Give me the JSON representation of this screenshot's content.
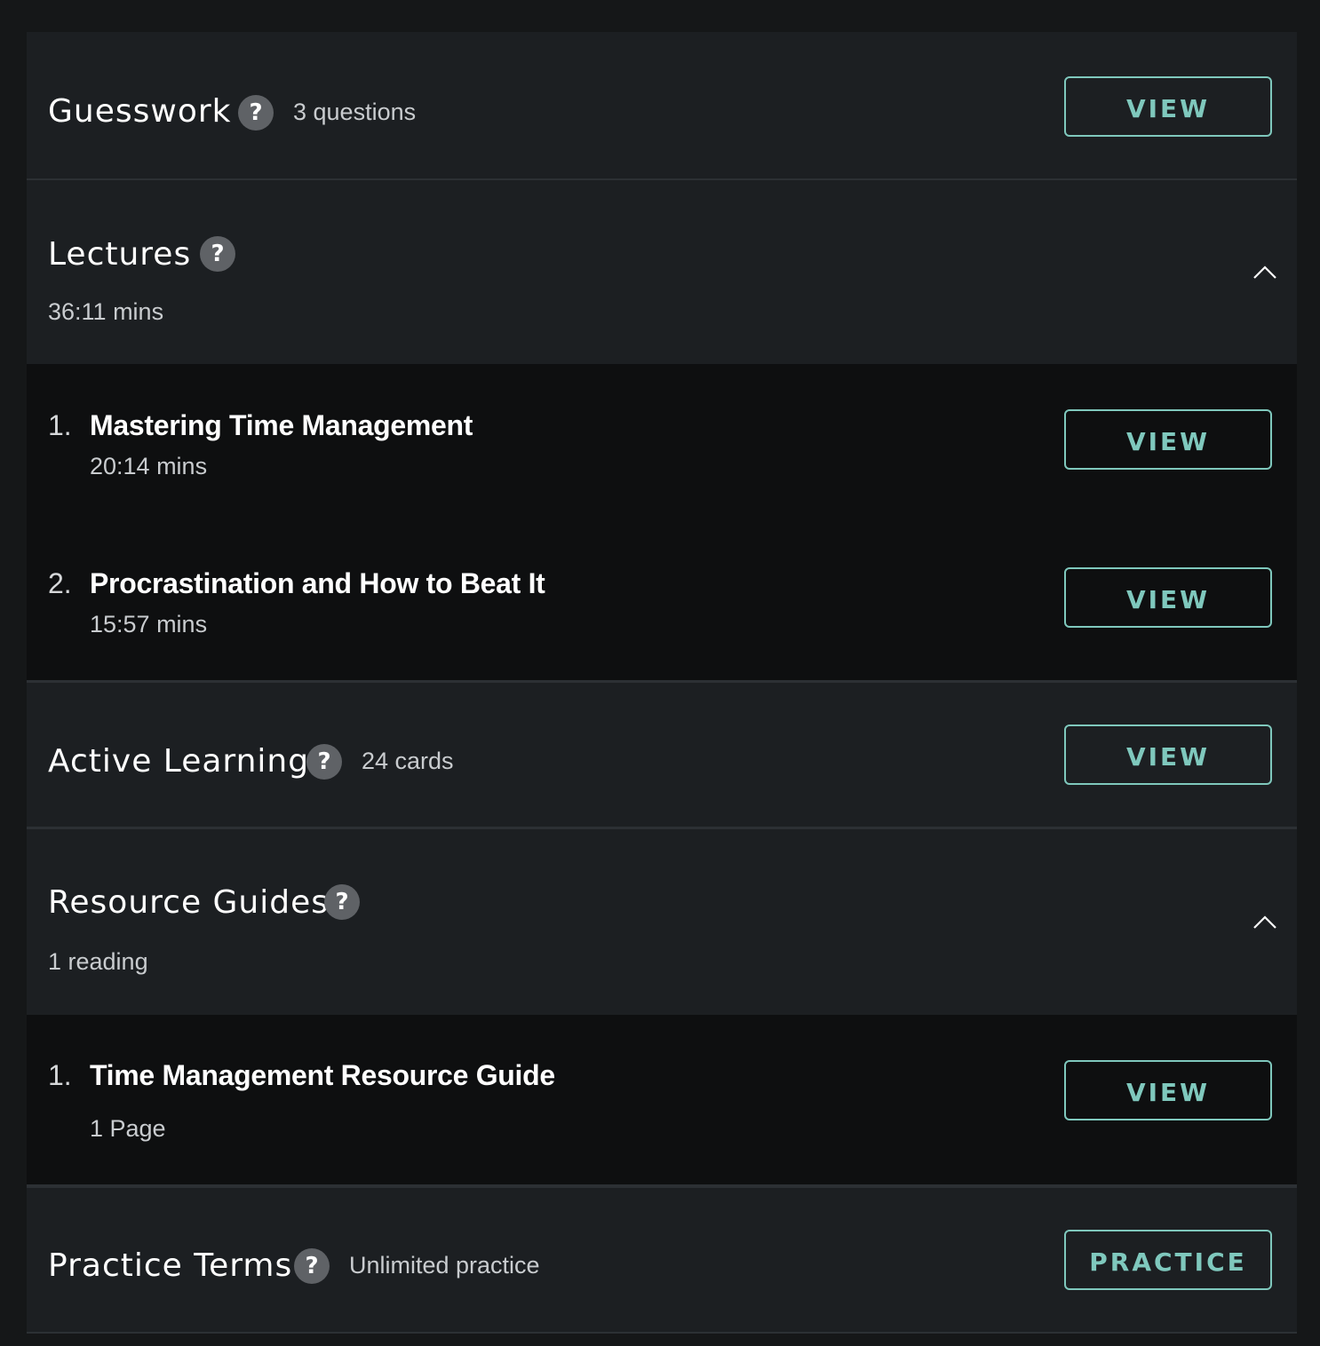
{
  "guesswork": {
    "title": "Guesswork",
    "help_icon": "question-mark-icon",
    "meta": "3 questions",
    "button_label": "VIEW"
  },
  "lectures": {
    "title": "Lectures",
    "help_icon": "question-mark-icon",
    "meta": "36:11 mins",
    "expanded": true,
    "items": [
      {
        "number": "1.",
        "title": "Mastering Time Management",
        "duration": "20:14 mins",
        "button_label": "VIEW"
      },
      {
        "number": "2.",
        "title": "Procrastination and How to Beat It",
        "duration": "15:57 mins",
        "button_label": "VIEW"
      }
    ]
  },
  "active_learning": {
    "title": "Active Learning",
    "help_icon": "question-mark-icon",
    "meta": "24 cards",
    "button_label": "VIEW"
  },
  "resource_guides": {
    "title": "Resource Guides",
    "help_icon": "question-mark-icon",
    "meta": "1 reading",
    "expanded": true,
    "items": [
      {
        "number": "1.",
        "title": "Time Management Resource Guide",
        "detail": "1 Page",
        "button_label": "VIEW"
      }
    ]
  },
  "practice_terms": {
    "title": "Practice Terms",
    "help_icon": "question-mark-icon",
    "meta": "Unlimited practice",
    "button_label": "PRACTICE"
  },
  "help_glyph": "?",
  "colors": {
    "page_bg": "#151718",
    "panel_bg": "#1c1f22",
    "sublist_bg": "#0e0f10",
    "accent": "#7fc8bd",
    "help_icon_bg": "#5f6266"
  }
}
